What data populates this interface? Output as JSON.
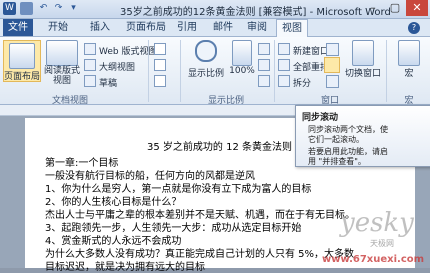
{
  "window": {
    "title": "35岁之前成功的12条黄金法则 [兼容模式] - Microsoft Word",
    "minimize": "–",
    "maximize": "▢",
    "close": "✕"
  },
  "tabs": [
    "文件",
    "开始",
    "插入",
    "页面布局",
    "引用",
    "邮件",
    "审阅",
    "视图"
  ],
  "ribbon": {
    "layout_view": "页面布局",
    "reading_view": "阅读版式视图",
    "web_view": "Web 版式视图",
    "outline": "大纲视图",
    "draft": "草稿",
    "views_group": "文档视图",
    "zoom": "显示比例",
    "hundred": "100%",
    "show_group": "显示比例",
    "new_window": "新建窗口",
    "arrange_all": "全部重排",
    "split": "拆分",
    "switch_window": "切换窗口",
    "macro": "宏",
    "window_group": "窗口",
    "macro_group": "宏"
  },
  "tooltip": {
    "title": "同步滚动",
    "line1": "同步滚动两个文档，使",
    "line2": "它们一起滚动。",
    "line3": "若要启用此功能，请启",
    "line4": "用 \"并排查看\"。"
  },
  "document": {
    "heading": "35 岁之前成功的 12 条黄金法则",
    "lines": [
      "第一章:一个目标",
      "一般没有航行目标的船，任何方向的风都是逆风",
      "1、你为什么是穷人，第一点就是你没有立下成为富人的目标",
      "2、你的人生核心目标是什么？",
      "杰出人士与平庸之辈的根本差别并不是天赋、机遇，而在于有无目标。",
      "3、起跑领先一步，人生领先一大步：成功从选定目标开始",
      "4、赏金斯式的人永远不会成功",
      "为什么大多数人没有成功？真正能完成自己计划的人只有 5%，大多数",
      "目标迟迟，就是决为拥有远大的目标"
    ]
  },
  "watermark": {
    "brand": "yesky",
    "sub": "天极网",
    "site": "www.67xuexi.com"
  }
}
